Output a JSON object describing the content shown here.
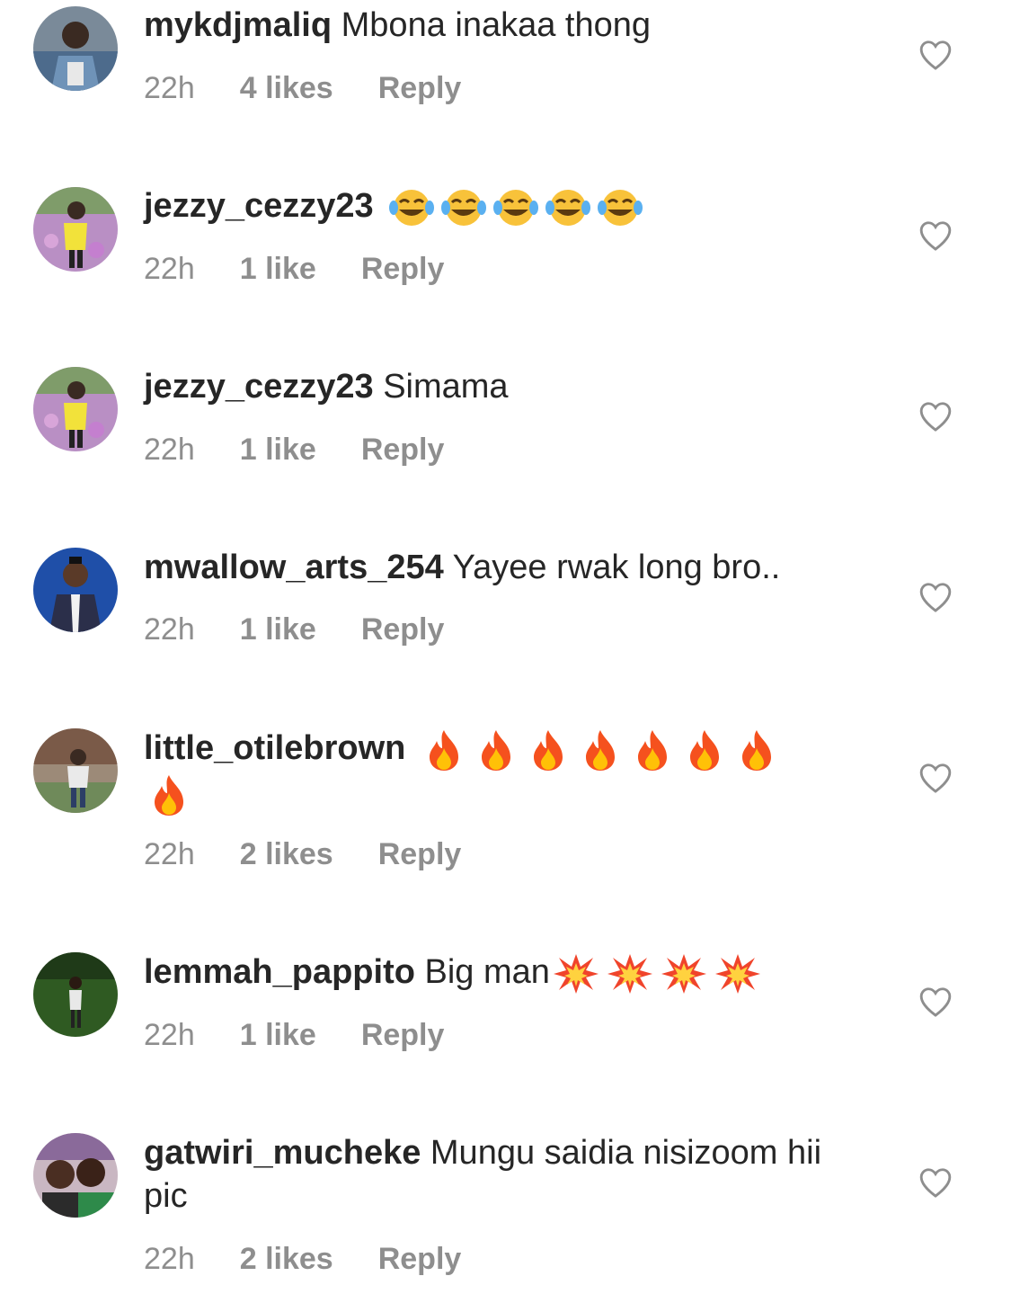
{
  "colors": {
    "username": "#262626",
    "meta": "#8e8e8e",
    "heart_outline": "#8e8e8e"
  },
  "comments": [
    {
      "username": "mykdjmaliq",
      "text": "Mbona inakaa thong",
      "emojis": [],
      "time": "22h",
      "likes": "4 likes",
      "reply": "Reply",
      "avatar_icon": "avatar-denim-jacket"
    },
    {
      "username": "jezzy_cezzy23",
      "text": "",
      "emojis": [
        "😂",
        "😂",
        "😂",
        "😂",
        "😂"
      ],
      "emoji_icon": "tears-of-joy-emoji",
      "time": "22h",
      "likes": "1 like",
      "reply": "Reply",
      "avatar_icon": "avatar-flower-field"
    },
    {
      "username": "jezzy_cezzy23",
      "text": "Simama",
      "emojis": [],
      "time": "22h",
      "likes": "1 like",
      "reply": "Reply",
      "avatar_icon": "avatar-flower-field"
    },
    {
      "username": "mwallow_arts_254",
      "text": "Yayee rwak long bro..",
      "emojis": [],
      "time": "22h",
      "likes": "1 like",
      "reply": "Reply",
      "avatar_icon": "avatar-blue-background"
    },
    {
      "username": "little_otilebrown",
      "text": "",
      "emojis": [
        "🔥",
        "🔥",
        "🔥",
        "🔥",
        "🔥",
        "🔥",
        "🔥",
        "🔥"
      ],
      "emoji_icon": "fire-emoji",
      "time": "22h",
      "likes": "2 likes",
      "reply": "Reply",
      "avatar_icon": "avatar-outdoor-building"
    },
    {
      "username": "lemmah_pappito",
      "text": "Big man",
      "emojis": [
        "💥",
        "💥",
        "💥",
        "💥"
      ],
      "emoji_icon": "collision-emoji",
      "time": "22h",
      "likes": "1 like",
      "reply": "Reply",
      "avatar_icon": "avatar-green-field"
    },
    {
      "username": "gatwiri_mucheke",
      "text": "Mungu saidia nisizoom hii pic",
      "emojis": [],
      "time": "22h",
      "likes": "2 likes",
      "reply": "Reply",
      "avatar_icon": "avatar-selfie"
    }
  ],
  "icons": {
    "like": "heart-outline-icon"
  }
}
